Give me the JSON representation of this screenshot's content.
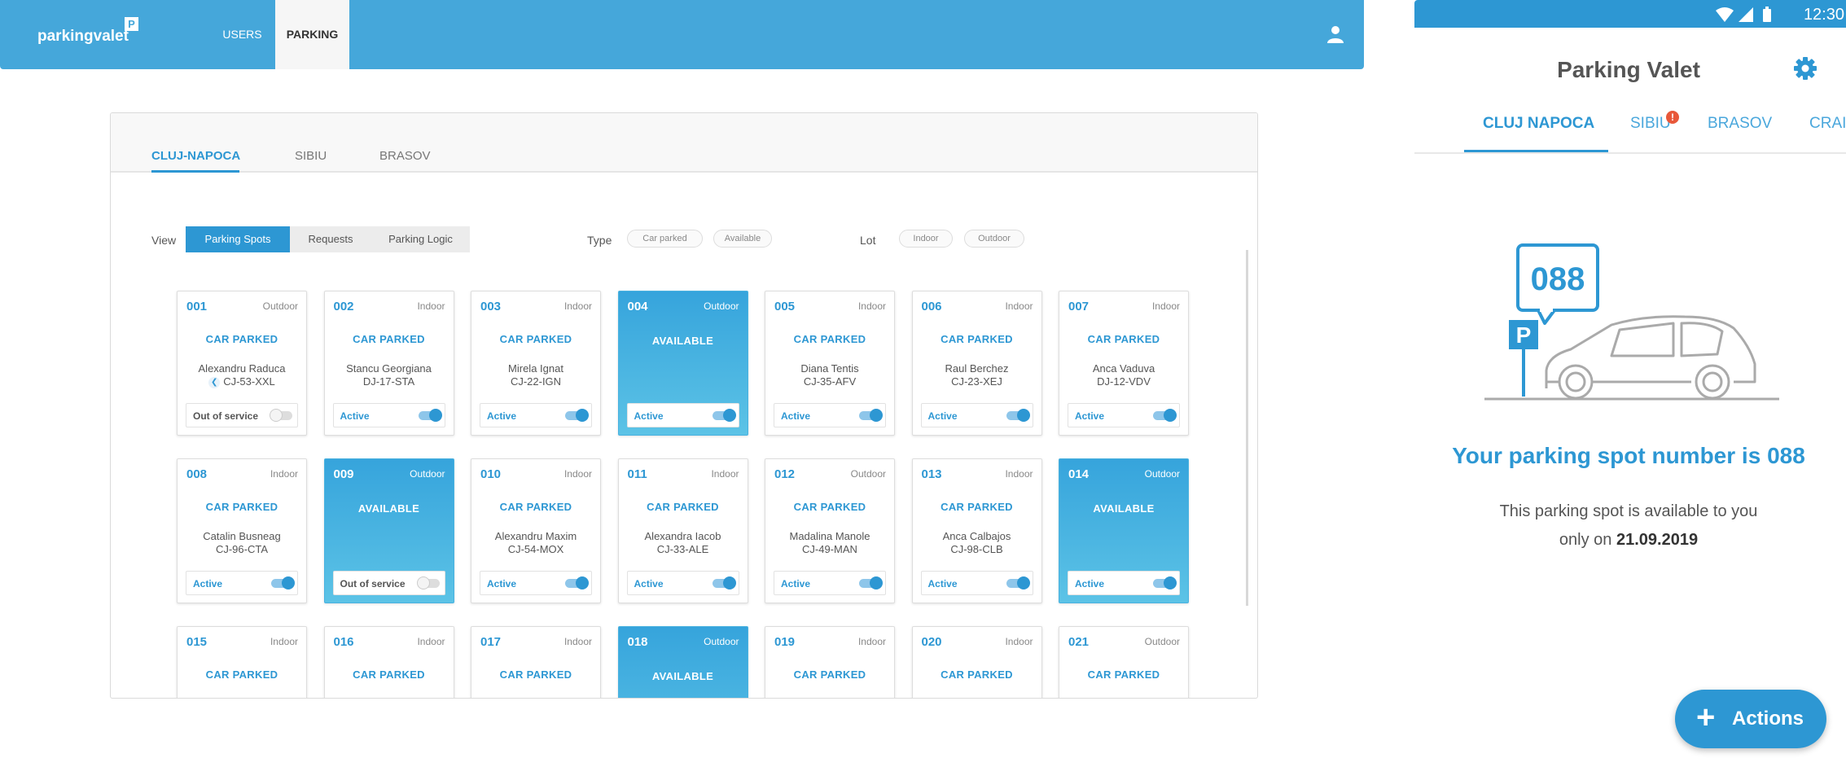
{
  "desktop": {
    "brand": "parkingvalet",
    "brand_badge": "P",
    "nav": {
      "users": "USERS",
      "parking": "PARKING"
    },
    "icons": {
      "account": "account-icon"
    },
    "city_tabs": [
      "CLUJ-NAPOCA",
      "SIBIU",
      "BRASOV"
    ],
    "active_city": "CLUJ-NAPOCA",
    "filters": {
      "view_label": "View",
      "view_options": [
        "Parking Spots",
        "Requests",
        "Parking Logic"
      ],
      "view_selected": "Parking Spots",
      "type_label": "Type",
      "type_chips": [
        "Car parked",
        "Available"
      ],
      "lot_label": "Lot",
      "lot_chips": [
        "Indoor",
        "Outdoor"
      ]
    },
    "spots": [
      {
        "num": "001",
        "lot": "Outdoor",
        "status": "CAR PARKED",
        "name": "Alexandru Raduca",
        "plate": "CJ-53-XXL",
        "control": "Out of service",
        "active": false,
        "back": true
      },
      {
        "num": "002",
        "lot": "Indoor",
        "status": "CAR PARKED",
        "name": "Stancu Georgiana",
        "plate": "DJ-17-STA",
        "control": "Active",
        "active": true
      },
      {
        "num": "003",
        "lot": "Indoor",
        "status": "CAR PARKED",
        "name": "Mirela Ignat",
        "plate": "CJ-22-IGN",
        "control": "Active",
        "active": true
      },
      {
        "num": "004",
        "lot": "Outdoor",
        "status": "AVAILABLE",
        "control": "Active",
        "active": true
      },
      {
        "num": "005",
        "lot": "Indoor",
        "status": "CAR PARKED",
        "name": "Diana Tentis",
        "plate": "CJ-35-AFV",
        "control": "Active",
        "active": true
      },
      {
        "num": "006",
        "lot": "Indoor",
        "status": "CAR PARKED",
        "name": "Raul Berchez",
        "plate": "CJ-23-XEJ",
        "control": "Active",
        "active": true
      },
      {
        "num": "007",
        "lot": "Indoor",
        "status": "CAR PARKED",
        "name": "Anca Vaduva",
        "plate": "DJ-12-VDV",
        "control": "Active",
        "active": true
      },
      {
        "num": "008",
        "lot": "Indoor",
        "status": "CAR PARKED",
        "name": "Catalin Busneag",
        "plate": "CJ-96-CTA",
        "control": "Active",
        "active": true
      },
      {
        "num": "009",
        "lot": "Outdoor",
        "status": "AVAILABLE",
        "control": "Out of service",
        "active": false
      },
      {
        "num": "010",
        "lot": "Indoor",
        "status": "CAR PARKED",
        "name": "Alexandru Maxim",
        "plate": "CJ-54-MOX",
        "control": "Active",
        "active": true
      },
      {
        "num": "011",
        "lot": "Indoor",
        "status": "CAR PARKED",
        "name": "Alexandra Iacob",
        "plate": "CJ-33-ALE",
        "control": "Active",
        "active": true
      },
      {
        "num": "012",
        "lot": "Outdoor",
        "status": "CAR PARKED",
        "name": "Madalina Manole",
        "plate": "CJ-49-MAN",
        "control": "Active",
        "active": true
      },
      {
        "num": "013",
        "lot": "Indoor",
        "status": "CAR PARKED",
        "name": "Anca Calbajos",
        "plate": "CJ-98-CLB",
        "control": "Active",
        "active": true
      },
      {
        "num": "014",
        "lot": "Outdoor",
        "status": "AVAILABLE",
        "control": "Active",
        "active": true
      },
      {
        "num": "015",
        "lot": "Indoor",
        "status": "CAR PARKED"
      },
      {
        "num": "016",
        "lot": "Indoor",
        "status": "CAR PARKED"
      },
      {
        "num": "017",
        "lot": "Indoor",
        "status": "CAR PARKED"
      },
      {
        "num": "018",
        "lot": "Outdoor",
        "status": "AVAILABLE"
      },
      {
        "num": "019",
        "lot": "Indoor",
        "status": "CAR PARKED"
      },
      {
        "num": "020",
        "lot": "Indoor",
        "status": "CAR PARKED"
      },
      {
        "num": "021",
        "lot": "Outdoor",
        "status": "CAR PARKED"
      }
    ]
  },
  "mobile": {
    "status_time": "12:30",
    "title": "Parking Valet",
    "icons": {
      "settings": "gear-icon",
      "wifi": "wifi-icon",
      "signal": "signal-icon",
      "battery": "battery-icon"
    },
    "tabs": [
      "CLUJ NAPOCA",
      "SIBIU",
      "BRASOV",
      "CRAIOVA"
    ],
    "active_tab": "CLUJ NAPOCA",
    "sibiu_badge": "!",
    "spot_number": "088",
    "parking_sign": "P",
    "headline": "Your parking spot number is 088",
    "sub_line1": "This parking spot is available to you",
    "sub_line2_prefix": "only on ",
    "sub_date": "21.09.2019",
    "fab_plus": "+",
    "fab_label": "Actions"
  },
  "colors": {
    "primary": "#2d97d3",
    "topbar": "#45a7da",
    "alert": "#e8583a"
  }
}
